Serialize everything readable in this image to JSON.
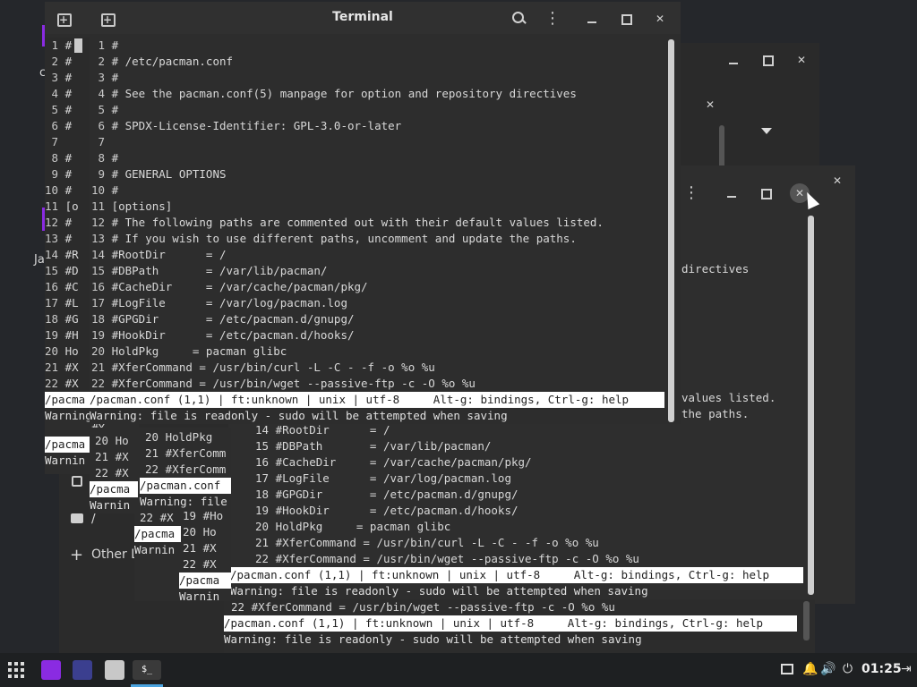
{
  "colors": {
    "accent_purple": "#8a2be2",
    "terminal_bg": "#2d2d2d",
    "taskbar": "#1e2022",
    "status_bg": "#ffffff"
  },
  "main_terminal": {
    "title": "Terminal",
    "left_pane_lines": [
      "#",
      "#",
      "#",
      "#",
      "#",
      "#",
      "",
      "#",
      "#",
      "#",
      "[o",
      "#",
      "#",
      "#R",
      "#D",
      "#C",
      "#L",
      "#G",
      "#H",
      "Ho",
      "#X",
      "#X"
    ],
    "lines": [
      "#",
      "# /etc/pacman.conf",
      "#",
      "# See the pacman.conf(5) manpage for option and repository directives",
      "#",
      "# SPDX-License-Identifier: GPL-3.0-or-later",
      "",
      "#",
      "# GENERAL OPTIONS",
      "#",
      "[options]",
      "# The following paths are commented out with their default values listed.",
      "# If you wish to use different paths, uncomment and update the paths.",
      "#RootDir      = /",
      "#DBPath       = /var/lib/pacman/",
      "#CacheDir     = /var/cache/pacman/pkg/",
      "#LogFile      = /var/log/pacman.log",
      "#GPGDir       = /etc/pacman.d/gnupg/",
      "#HookDir      = /etc/pacman.d/hooks/",
      "HoldPkg     = pacman glibc",
      "#XferCommand = /usr/bin/curl -L -C - -f -o %o %u",
      "#XferCommand = /usr/bin/wget --passive-ftp -c -O %o %u"
    ],
    "status_left": "/pacma",
    "status": "/pacman.conf (1,1) | ft:unknown | unix | utf-8     Alt-g: bindings, Ctrl-g: help",
    "warning_left": "Warning",
    "warning": "Warning: file is readonly - sudo will be attempted when saving"
  },
  "back_terminal": {
    "peek_right_lines": [
      "directives",
      "values listed.",
      "the paths."
    ],
    "lines": [
      "14 #RootDir      = /",
      "15 #DBPath       = /var/lib/pacman/",
      "16 #CacheDir     = /var/cache/pacman/pkg/",
      "17 #LogFile      = /var/log/pacman.log",
      "18 #GPGDir       = /etc/pacman.d/gnupg/",
      "19 #HookDir      = /etc/pacman.d/hooks/",
      "20 HoldPkg     = pacman glibc",
      "21 #XferCommand = /usr/bin/curl -L -C - -f -o %o %u",
      "22 #XferCommand = /usr/bin/wget --passive-ftp -c -O %o %u"
    ],
    "status": "/pacman.conf (1,1) | ft:unknown | unix | utf-8     Alt-g: bindings, Ctrl-g: help",
    "warning": "Warning: file is readonly - sudo will be attempted when saving"
  },
  "bottom_terminal": {
    "line": "22 #XferCommand = /usr/bin/wget --passive-ftp -c -O %o %u",
    "status": "/pacman.conf (1,1) | ft:unknown | unix | utf-8     Alt-g: bindings, Ctrl-g: help",
    "warning": "Warning: file is readonly - sudo will be attempted when saving"
  },
  "fragments": {
    "f1": [
      "#X",
      "20 Ho",
      "21 #X",
      "22 #X"
    ],
    "f1_status": "/pacma",
    "f1_warn": "Warnin",
    "f2": [
      "20 HoldPkg",
      "21 #XferComm",
      "22 #XferComm"
    ],
    "f2_status": "/pacman.conf",
    "f2_warn": "Warning: file",
    "f3": [
      "22 #X",
      "19 #Ho",
      "20 Ho",
      "21 #X",
      "22 #X"
    ],
    "f3_status": "/pacma",
    "f3_warn": "Warnin",
    "left_warn": [
      "/pacma",
      "Warnin"
    ]
  },
  "file_manager": {
    "path": "/",
    "other_locations": "Other Locations",
    "side_label_a": "c",
    "side_label_b": "Ja"
  },
  "taskbar": {
    "clock": "01:25",
    "apps": [
      "apps-grid-icon",
      "purple-app-icon",
      "network-app-icon",
      "files-app-icon",
      "terminal-app-icon"
    ]
  }
}
